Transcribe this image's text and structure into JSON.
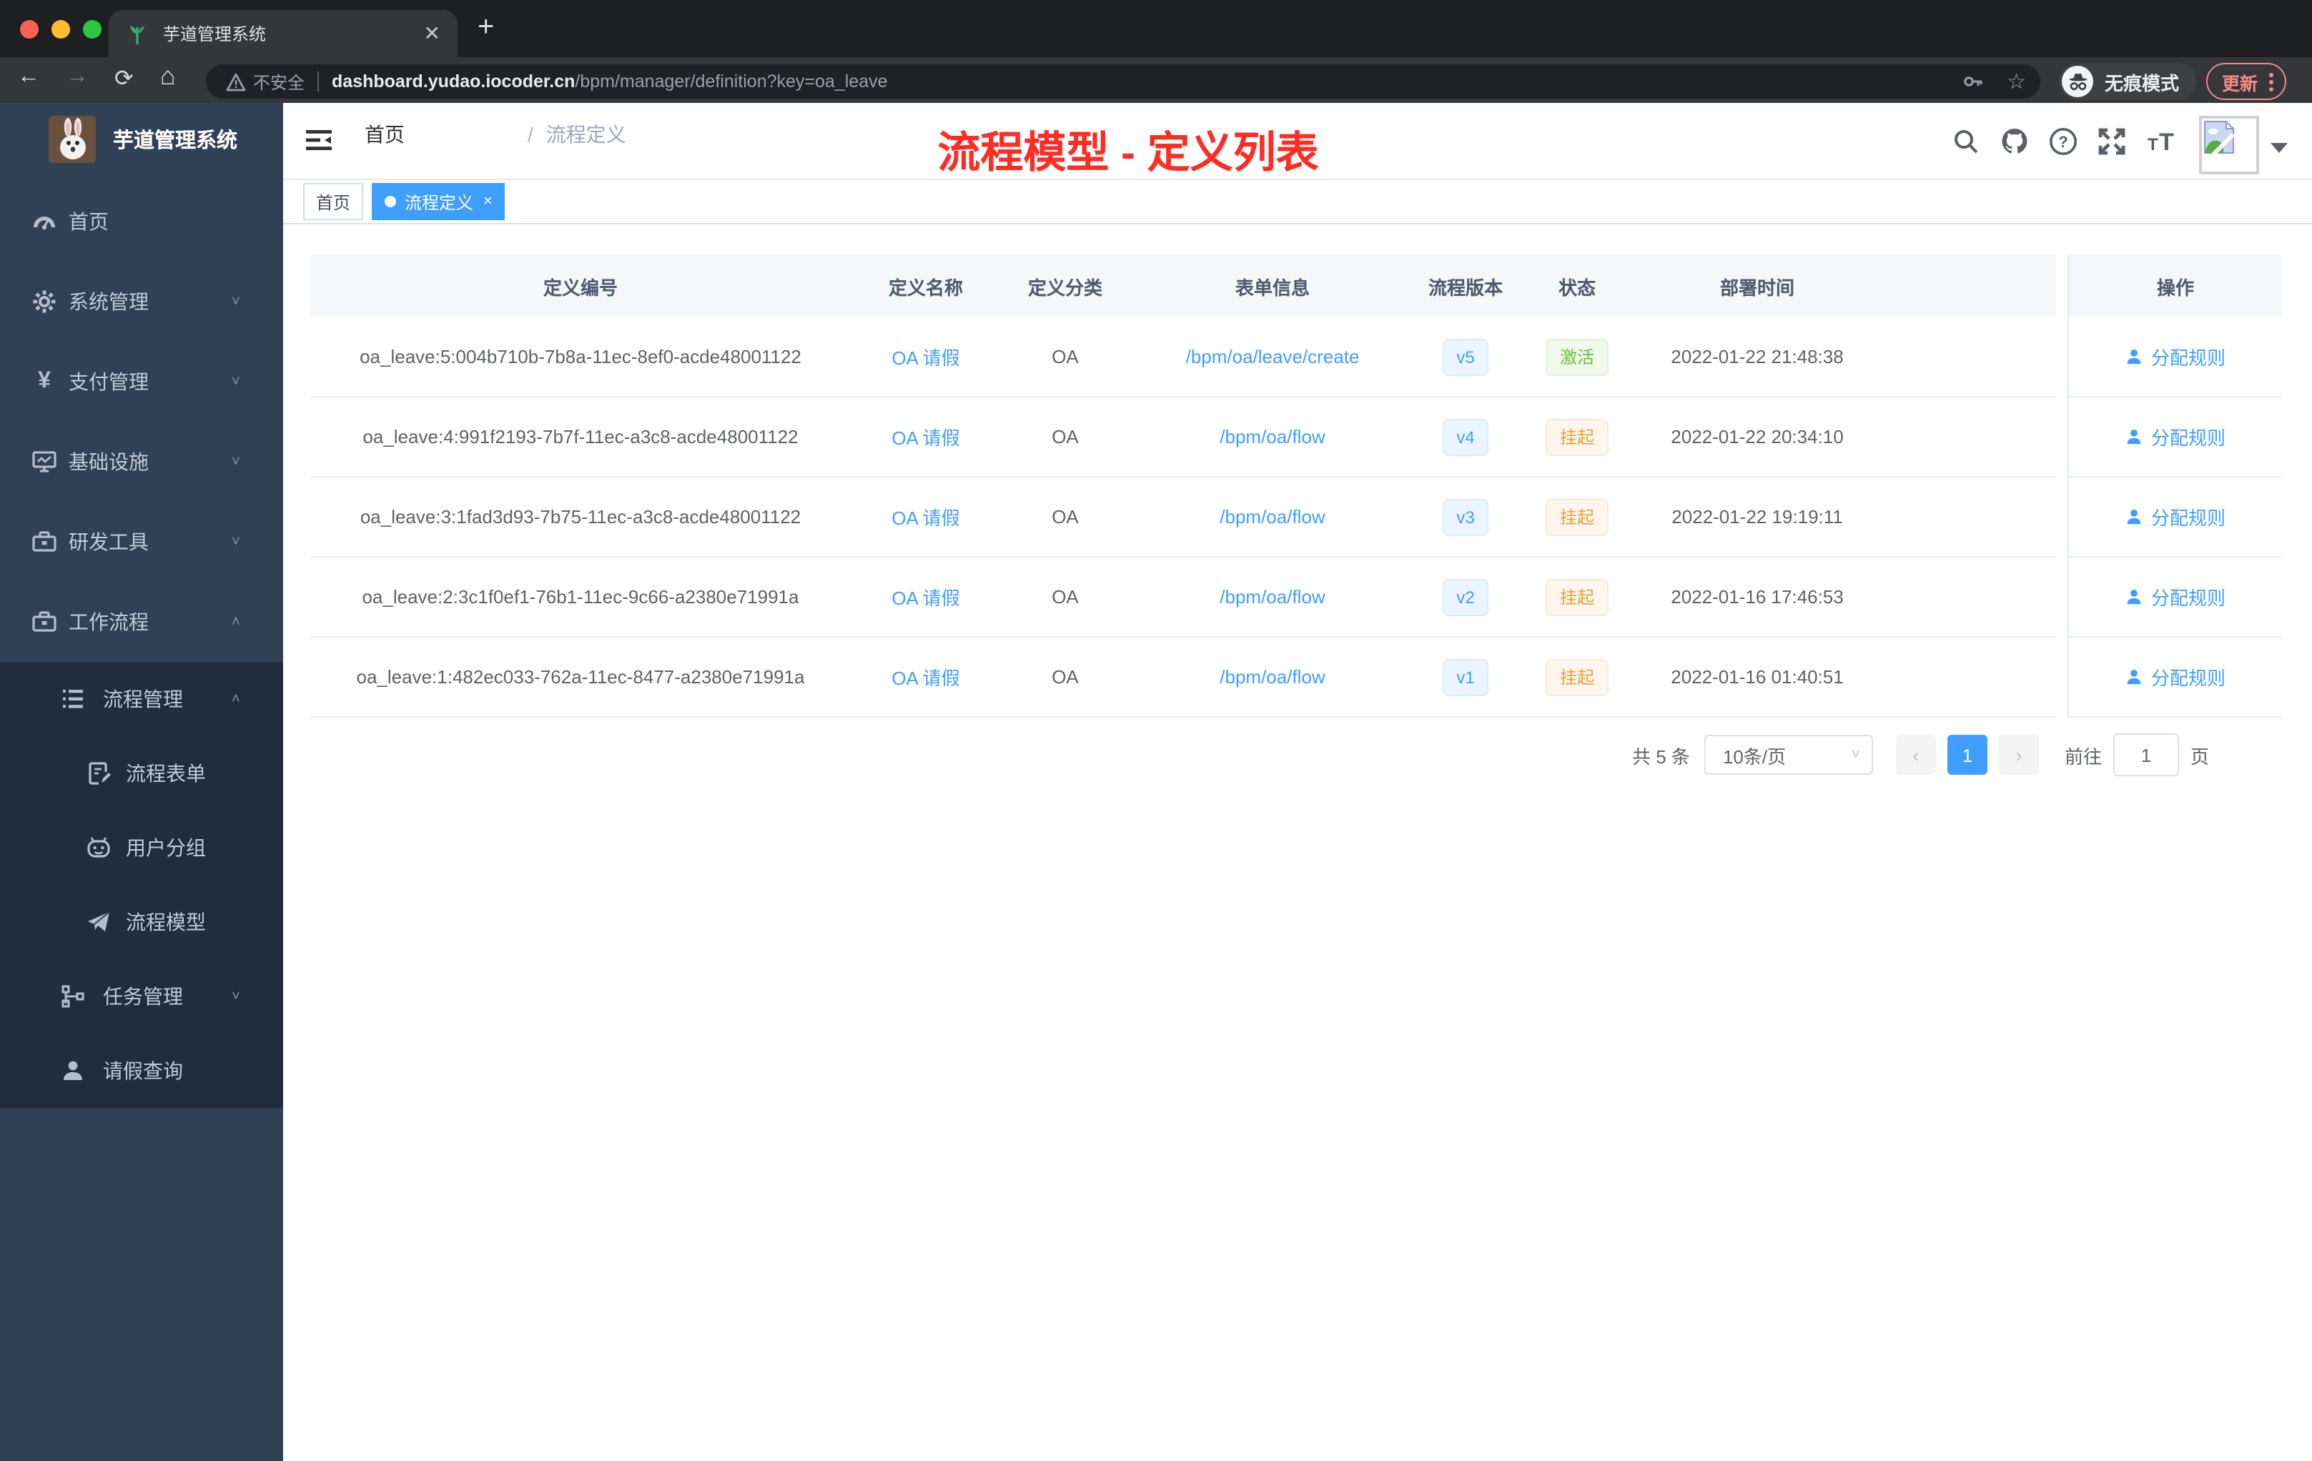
{
  "browser": {
    "tab_title": "芋道管理系统",
    "new_tab": "+",
    "close_tab": "✕",
    "security_label": "不安全",
    "url_host": "dashboard.yudao.iocoder.cn",
    "url_path": "/bpm/manager/definition?key=oa_leave",
    "incognito_label": "无痕模式",
    "update_label": "更新"
  },
  "sidebar": {
    "logo_title": "芋道管理系统",
    "items": [
      {
        "label": "首页",
        "icon": "dashboard-icon",
        "level": 1,
        "chevron": "",
        "dark": false
      },
      {
        "label": "系统管理",
        "icon": "gear-icon",
        "level": 1,
        "chevron": "down",
        "dark": false
      },
      {
        "label": "支付管理",
        "icon": "yen-icon",
        "level": 1,
        "chevron": "down",
        "dark": false
      },
      {
        "label": "基础设施",
        "icon": "monitor-icon",
        "level": 1,
        "chevron": "down",
        "dark": false
      },
      {
        "label": "研发工具",
        "icon": "toolbox-icon",
        "level": 1,
        "chevron": "down",
        "dark": false
      },
      {
        "label": "工作流程",
        "icon": "briefcase-icon",
        "level": 1,
        "chevron": "up",
        "dark": false
      },
      {
        "label": "流程管理",
        "icon": "list-tree-icon",
        "level": 2,
        "chevron": "up",
        "dark": true
      },
      {
        "label": "流程表单",
        "icon": "form-edit-icon",
        "level": 3,
        "chevron": "",
        "dark": true
      },
      {
        "label": "用户分组",
        "icon": "robot-face-icon",
        "level": 3,
        "chevron": "",
        "dark": true
      },
      {
        "label": "流程模型",
        "icon": "paper-plane-icon",
        "level": 3,
        "chevron": "",
        "dark": true
      },
      {
        "label": "任务管理",
        "icon": "org-tree-icon",
        "level": 2,
        "chevron": "down",
        "dark": true
      },
      {
        "label": "请假查询",
        "icon": "user-icon",
        "level": 2,
        "chevron": "",
        "dark": true
      }
    ]
  },
  "header": {
    "breadcrumb_home": "首页",
    "breadcrumb_sep": "/",
    "breadcrumb_current": "流程定义",
    "annotation": "流程模型 - 定义列表"
  },
  "tags": {
    "home": "首页",
    "active": "流程定义",
    "active_close": "×"
  },
  "table": {
    "columns": [
      "定义编号",
      "定义名称",
      "定义分类",
      "表单信息",
      "流程版本",
      "状态",
      "部署时间"
    ],
    "action_column": "操作",
    "action_label": "分配规则",
    "rows": [
      {
        "id": "oa_leave:5:004b710b-7b8a-11ec-8ef0-acde48001122",
        "name": "OA 请假",
        "category": "OA",
        "form": "/bpm/oa/leave/create",
        "version": "v5",
        "status": "激活",
        "status_type": "success",
        "time": "2022-01-22 21:48:38"
      },
      {
        "id": "oa_leave:4:991f2193-7b7f-11ec-a3c8-acde48001122",
        "name": "OA 请假",
        "category": "OA",
        "form": "/bpm/oa/flow",
        "version": "v4",
        "status": "挂起",
        "status_type": "warning",
        "time": "2022-01-22 20:34:10"
      },
      {
        "id": "oa_leave:3:1fad3d93-7b75-11ec-a3c8-acde48001122",
        "name": "OA 请假",
        "category": "OA",
        "form": "/bpm/oa/flow",
        "version": "v3",
        "status": "挂起",
        "status_type": "warning",
        "time": "2022-01-22 19:19:11"
      },
      {
        "id": "oa_leave:2:3c1f0ef1-76b1-11ec-9c66-a2380e71991a",
        "name": "OA 请假",
        "category": "OA",
        "form": "/bpm/oa/flow",
        "version": "v2",
        "status": "挂起",
        "status_type": "warning",
        "time": "2022-01-16 17:46:53"
      },
      {
        "id": "oa_leave:1:482ec033-762a-11ec-8477-a2380e71991a",
        "name": "OA 请假",
        "category": "OA",
        "form": "/bpm/oa/flow",
        "version": "v1",
        "status": "挂起",
        "status_type": "warning",
        "time": "2022-01-16 01:40:51"
      }
    ]
  },
  "pagination": {
    "total": "共 5 条",
    "page_size": "10条/页",
    "prev": "‹",
    "next": "›",
    "current_page": "1",
    "goto_label": "前往",
    "goto_value": "1",
    "page_unit": "页"
  },
  "colors": {
    "accent_blue": "#409eff",
    "success_green": "#67c23a",
    "warning_orange": "#e6a23c",
    "sidebar_bg": "#304156",
    "sidebar_sub_bg": "#1f2d3d",
    "annotation_red": "#fe2c23",
    "chrome_update_red": "#f28b82"
  }
}
